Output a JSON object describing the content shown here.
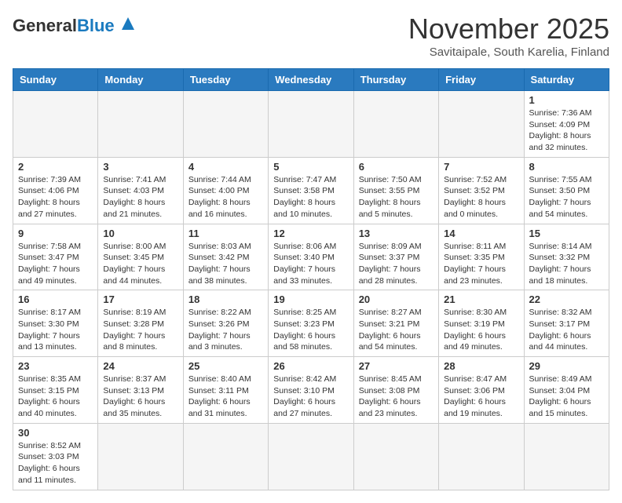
{
  "header": {
    "logo_general": "General",
    "logo_blue": "Blue",
    "month_year": "November 2025",
    "location": "Savitaipale, South Karelia, Finland"
  },
  "weekdays": [
    "Sunday",
    "Monday",
    "Tuesday",
    "Wednesday",
    "Thursday",
    "Friday",
    "Saturday"
  ],
  "weeks": [
    [
      {
        "day": "",
        "info": ""
      },
      {
        "day": "",
        "info": ""
      },
      {
        "day": "",
        "info": ""
      },
      {
        "day": "",
        "info": ""
      },
      {
        "day": "",
        "info": ""
      },
      {
        "day": "",
        "info": ""
      },
      {
        "day": "1",
        "info": "Sunrise: 7:36 AM\nSunset: 4:09 PM\nDaylight: 8 hours and 32 minutes."
      }
    ],
    [
      {
        "day": "2",
        "info": "Sunrise: 7:39 AM\nSunset: 4:06 PM\nDaylight: 8 hours and 27 minutes."
      },
      {
        "day": "3",
        "info": "Sunrise: 7:41 AM\nSunset: 4:03 PM\nDaylight: 8 hours and 21 minutes."
      },
      {
        "day": "4",
        "info": "Sunrise: 7:44 AM\nSunset: 4:00 PM\nDaylight: 8 hours and 16 minutes."
      },
      {
        "day": "5",
        "info": "Sunrise: 7:47 AM\nSunset: 3:58 PM\nDaylight: 8 hours and 10 minutes."
      },
      {
        "day": "6",
        "info": "Sunrise: 7:50 AM\nSunset: 3:55 PM\nDaylight: 8 hours and 5 minutes."
      },
      {
        "day": "7",
        "info": "Sunrise: 7:52 AM\nSunset: 3:52 PM\nDaylight: 8 hours and 0 minutes."
      },
      {
        "day": "8",
        "info": "Sunrise: 7:55 AM\nSunset: 3:50 PM\nDaylight: 7 hours and 54 minutes."
      }
    ],
    [
      {
        "day": "9",
        "info": "Sunrise: 7:58 AM\nSunset: 3:47 PM\nDaylight: 7 hours and 49 minutes."
      },
      {
        "day": "10",
        "info": "Sunrise: 8:00 AM\nSunset: 3:45 PM\nDaylight: 7 hours and 44 minutes."
      },
      {
        "day": "11",
        "info": "Sunrise: 8:03 AM\nSunset: 3:42 PM\nDaylight: 7 hours and 38 minutes."
      },
      {
        "day": "12",
        "info": "Sunrise: 8:06 AM\nSunset: 3:40 PM\nDaylight: 7 hours and 33 minutes."
      },
      {
        "day": "13",
        "info": "Sunrise: 8:09 AM\nSunset: 3:37 PM\nDaylight: 7 hours and 28 minutes."
      },
      {
        "day": "14",
        "info": "Sunrise: 8:11 AM\nSunset: 3:35 PM\nDaylight: 7 hours and 23 minutes."
      },
      {
        "day": "15",
        "info": "Sunrise: 8:14 AM\nSunset: 3:32 PM\nDaylight: 7 hours and 18 minutes."
      }
    ],
    [
      {
        "day": "16",
        "info": "Sunrise: 8:17 AM\nSunset: 3:30 PM\nDaylight: 7 hours and 13 minutes."
      },
      {
        "day": "17",
        "info": "Sunrise: 8:19 AM\nSunset: 3:28 PM\nDaylight: 7 hours and 8 minutes."
      },
      {
        "day": "18",
        "info": "Sunrise: 8:22 AM\nSunset: 3:26 PM\nDaylight: 7 hours and 3 minutes."
      },
      {
        "day": "19",
        "info": "Sunrise: 8:25 AM\nSunset: 3:23 PM\nDaylight: 6 hours and 58 minutes."
      },
      {
        "day": "20",
        "info": "Sunrise: 8:27 AM\nSunset: 3:21 PM\nDaylight: 6 hours and 54 minutes."
      },
      {
        "day": "21",
        "info": "Sunrise: 8:30 AM\nSunset: 3:19 PM\nDaylight: 6 hours and 49 minutes."
      },
      {
        "day": "22",
        "info": "Sunrise: 8:32 AM\nSunset: 3:17 PM\nDaylight: 6 hours and 44 minutes."
      }
    ],
    [
      {
        "day": "23",
        "info": "Sunrise: 8:35 AM\nSunset: 3:15 PM\nDaylight: 6 hours and 40 minutes."
      },
      {
        "day": "24",
        "info": "Sunrise: 8:37 AM\nSunset: 3:13 PM\nDaylight: 6 hours and 35 minutes."
      },
      {
        "day": "25",
        "info": "Sunrise: 8:40 AM\nSunset: 3:11 PM\nDaylight: 6 hours and 31 minutes."
      },
      {
        "day": "26",
        "info": "Sunrise: 8:42 AM\nSunset: 3:10 PM\nDaylight: 6 hours and 27 minutes."
      },
      {
        "day": "27",
        "info": "Sunrise: 8:45 AM\nSunset: 3:08 PM\nDaylight: 6 hours and 23 minutes."
      },
      {
        "day": "28",
        "info": "Sunrise: 8:47 AM\nSunset: 3:06 PM\nDaylight: 6 hours and 19 minutes."
      },
      {
        "day": "29",
        "info": "Sunrise: 8:49 AM\nSunset: 3:04 PM\nDaylight: 6 hours and 15 minutes."
      }
    ],
    [
      {
        "day": "30",
        "info": "Sunrise: 8:52 AM\nSunset: 3:03 PM\nDaylight: 6 hours and 11 minutes."
      },
      {
        "day": "",
        "info": ""
      },
      {
        "day": "",
        "info": ""
      },
      {
        "day": "",
        "info": ""
      },
      {
        "day": "",
        "info": ""
      },
      {
        "day": "",
        "info": ""
      },
      {
        "day": "",
        "info": ""
      }
    ]
  ]
}
